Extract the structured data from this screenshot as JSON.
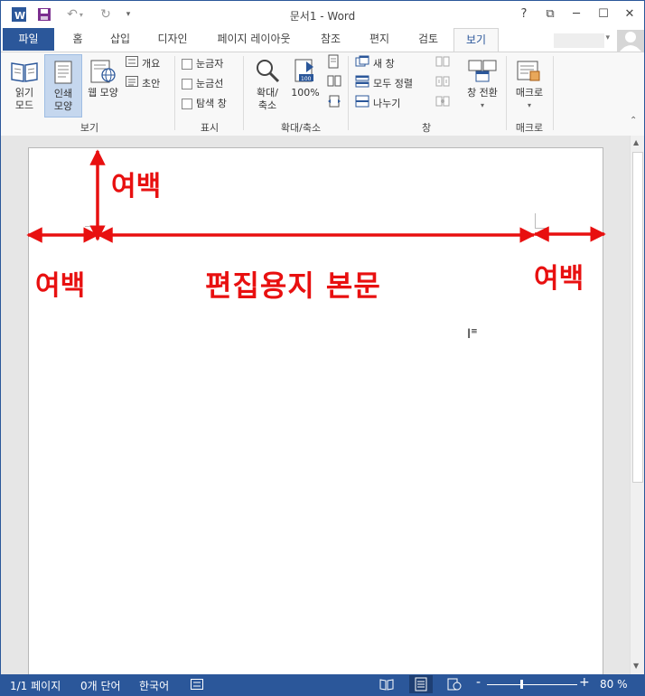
{
  "window": {
    "title": "문서1 - Word",
    "colors": {
      "accent": "#2b579a",
      "annotation": "#e81010"
    }
  },
  "quick_access": [
    "word-logo-icon",
    "save-icon",
    "undo-icon",
    "redo-icon",
    "customize-icon"
  ],
  "window_buttons": {
    "help": "?",
    "ribbon_display": "⧉",
    "minimize": "─",
    "maximize": "☐",
    "close": "✕"
  },
  "tabs": [
    {
      "label": "파일"
    },
    {
      "label": "홈"
    },
    {
      "label": "삽입"
    },
    {
      "label": "디자인"
    },
    {
      "label": "페이지 레이아웃"
    },
    {
      "label": "참조"
    },
    {
      "label": "편지"
    },
    {
      "label": "검토"
    },
    {
      "label": "보기"
    }
  ],
  "ribbon": {
    "groups": {
      "views": {
        "label": "보기",
        "read_mode": "읽기\n모드",
        "print_layout": "인쇄\n모양",
        "web_layout": "웹 모양",
        "outline": "개요",
        "draft": "초안"
      },
      "show": {
        "label": "표시",
        "ruler": "눈금자",
        "gridlines": "눈금선",
        "nav_pane": "탐색 창"
      },
      "zoom": {
        "label": "확대/축소",
        "zoom": "확대/\n축소",
        "hundred": "100%"
      },
      "window": {
        "label": "창",
        "new_window": "새 창",
        "arrange_all": "모두 정렬",
        "split": "나누기",
        "switch_windows": "창 전환"
      },
      "macros": {
        "label": "매크로",
        "macros": "매크로"
      }
    }
  },
  "annotations": {
    "top_margin": "여백",
    "left_margin": "여백",
    "body": "편집용지 본문",
    "right_margin": "여백"
  },
  "status_bar": {
    "page": "1/1 페이지",
    "words": "0개 단어",
    "language": "한국어",
    "zoom": "80 %",
    "zoom_minus": "-",
    "zoom_plus": "+"
  }
}
